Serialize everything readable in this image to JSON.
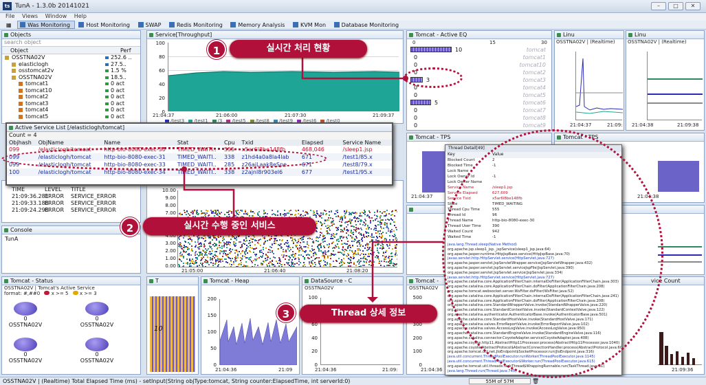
{
  "app": {
    "title": "TunA - 1.3.0b 20141021",
    "menu": [
      "File",
      "Views",
      "Window",
      "Help"
    ]
  },
  "toolbar": [
    "Was Monitoring",
    "Host Monitoring",
    "SWAP",
    "Redis Monitoring",
    "Memory Analysis",
    "KVM Mon",
    "Database Monitoring"
  ],
  "objects": {
    "title": "Objects",
    "search": "search object",
    "col_object": "Object",
    "col_perf": "Perf",
    "rows": [
      {
        "name": "OSSTNA02V",
        "perf": "252.6 .."
      },
      {
        "name": "elasticlogh",
        "perf": "27.5.."
      },
      {
        "name": "osstomcat2v",
        "perf": "1.5 %"
      },
      {
        "name": "OSSTNA02V",
        "perf": "18.5.."
      },
      {
        "name": "tomcat1",
        "perf": "0 act"
      },
      {
        "name": "tomcat10",
        "perf": "0 act"
      },
      {
        "name": "tomcat2",
        "perf": "0 act"
      },
      {
        "name": "tomcat3",
        "perf": "0 act"
      },
      {
        "name": "tomcat4",
        "perf": "0 act"
      },
      {
        "name": "tomcat5",
        "perf": "0 act"
      }
    ]
  },
  "throughput": {
    "title": "Service[Throughput]",
    "yticks": [
      "100",
      "80",
      "60",
      "40",
      "20",
      "0"
    ],
    "xticks": [
      "21:04:37",
      "21:06:00",
      "21:07:30",
      "21:09:37"
    ],
    "legend": [
      "/test3",
      "/test1",
      "/3",
      "/test5",
      "/test8",
      "/test9",
      "/test6",
      "/test0"
    ]
  },
  "active_eq": {
    "title": "Tomcat - Active EQ",
    "scale": [
      "0",
      "15",
      "30"
    ],
    "rows": [
      {
        "label": "tomcat",
        "count": "10"
      },
      {
        "label": "tomcat1",
        "count": "0"
      },
      {
        "label": "tomcat10",
        "count": "0"
      },
      {
        "label": "tomcat2",
        "count": "0"
      },
      {
        "label": "tomcat3",
        "count": "3"
      },
      {
        "label": "tomcat4",
        "count": "0"
      },
      {
        "label": "tomcat5",
        "count": "0"
      },
      {
        "label": "tomcat6",
        "count": "5"
      },
      {
        "label": "tomcat7",
        "count": "0"
      },
      {
        "label": "tomcat8",
        "count": "0"
      },
      {
        "label": "tomcat9",
        "count": "0"
      }
    ]
  },
  "linux1": {
    "title": "Linu",
    "subtitle": "OSSTNA02V | (Realtime)",
    "yticks": [
      "100",
      "80",
      "60",
      "40",
      "20",
      "0"
    ],
    "xticks": [
      "21:04:37",
      "21:09:"
    ]
  },
  "linux2": {
    "title": "Linu",
    "subtitle": "OSSTNA02V | (Realtime)",
    "yticks": [
      "100",
      "80",
      "60",
      "40",
      "20",
      "0"
    ],
    "xticks": [
      "21:04:38",
      "21:09:38"
    ]
  },
  "active_service": {
    "title": "Active Service List [/elasticlogh/tomcat]",
    "count": "Count = 4",
    "headers": [
      "Objhash",
      "ObjName",
      "Name",
      "Stat",
      "Cpu",
      "Txid",
      "Elapsed",
      "Service Name"
    ],
    "rows": [
      {
        "hash": "099",
        "obj": "/elasticlogh/tomcat",
        "name": "http-bio-8080-exec-30",
        "stat": "TIMED_WAITI..",
        "cpu": "555",
        "txid": "x5ar6l8be148fb",
        "elapsed": "468,046",
        "svc": "/sleep1.jsp"
      },
      {
        "hash": "099",
        "obj": "/elasticlogh/tomcat",
        "name": "http-bio-8080-exec-31",
        "stat": "TIMED_WAITI..",
        "cpu": "338",
        "txid": "z1hd4a0a8la4lab",
        "elapsed": "671",
        "svc": "/test1/85.x"
      },
      {
        "hash": "099",
        "obj": "/elasticlogh/tomcat",
        "name": "http-bio-8080-exec-33",
        "stat": "TIMED_WAITI..",
        "cpu": "285",
        "txid": "z26ajLaak8eSpe",
        "elapsed": "671",
        "svc": "/test8/79.x"
      },
      {
        "hash": "100",
        "obj": "/elasticlogh/tomcat",
        "name": "http-bio-8080-exec-34",
        "stat": "TIMED_WAITI..",
        "cpu": "338",
        "txid": "z2ajnl8r903el6",
        "elapsed": "677",
        "svc": "/test1/95.x"
      }
    ]
  },
  "alerts": {
    "headers": [
      "TIME",
      "LEVEL",
      "TITLE"
    ],
    "rows": [
      {
        "time": "21:09:36.281",
        "level": "ERROR",
        "title": "SERVICE_ERROR"
      },
      {
        "time": "21:09:33.188",
        "level": "ERROR",
        "title": "SERVICE_ERROR"
      },
      {
        "time": "21:09:24.298",
        "level": "ERROR",
        "title": "SERVICE_ERROR"
      }
    ]
  },
  "console": {
    "title": "Console",
    "text": "TunA"
  },
  "scatter": {
    "yticks": [
      "10.00",
      "9.00",
      "8.00",
      "7.00",
      "6.00",
      "5.00",
      "4.00",
      "3.00",
      "2.00",
      "1.00",
      "0.00"
    ],
    "xticks": [
      "21:05:00",
      "21:06:40",
      "21:08:20"
    ]
  },
  "status_panel": {
    "title": "Tomcat - Status",
    "subtitle": "OSSTNA02V | Tomcat's Active Service",
    "format": "format: #,##0",
    "legend1": "x >= 5",
    "legend2": "x >= 3",
    "items": [
      {
        "count": "0",
        "label": "OSSTNA02V"
      },
      {
        "count": "0",
        "label": "OSSTNA02V"
      },
      {
        "count": "0",
        "label": "OSSTNA02V"
      },
      {
        "count": "0",
        "label": "OSSTNA02V"
      }
    ]
  },
  "tps1": {
    "title": "Tomcat - TPS",
    "xtick": "21:04:37"
  },
  "tps2": {
    "title": "Tomcat - TPS",
    "xtick": "21:04:38"
  },
  "thread_detail": {
    "title": "Thread Detail[49]",
    "key": "Key",
    "value": "Value",
    "rows": [
      [
        "Blocked Count",
        "2"
      ],
      [
        "Blocked Time",
        "-1"
      ],
      [
        "Lock Name",
        ""
      ],
      [
        "Lock Owner Id",
        "-1"
      ],
      [
        "Lock Owner Name",
        ""
      ],
      [
        "Service Name",
        "/sleep1.jsp"
      ],
      [
        "Service Elapsed",
        "627,609"
      ],
      [
        "Service Txid",
        "x5ar6l8be148fb"
      ],
      [
        "State",
        "TIMED_WAITING"
      ],
      [
        "Thread Cpu Time",
        "555"
      ],
      [
        "Thread Id",
        "96"
      ],
      [
        "Thread Name",
        "http-bio-8080-exec-30"
      ],
      [
        "Thread User Time",
        "390"
      ],
      [
        "Waited Count",
        "942"
      ],
      [
        "Waited Time",
        "-1"
      ]
    ],
    "stack": [
      "java.lang.Thread.sleep(Native Method)",
      "org.apache.jsp.sleep1_jsp._jspService(sleep1_jsp.java:64)",
      "org.apache.jasper.runtime.HttpJspBase.service(HttpJspBase.java:70)",
      "javax.servlet.http.HttpServlet.service(HttpServlet.java:727)",
      "org.apache.jasper.servlet.JspServletWrapper.service(JspServletWrapper.java:432)",
      "org.apache.jasper.servlet.JspServlet.serviceJspFile(JspServlet.java:390)",
      "org.apache.jasper.servlet.JspServlet.service(JspServlet.java:334)",
      "javax.servlet.http.HttpServlet.service(HttpServlet.java:727)",
      "org.apache.catalina.core.ApplicationFilterChain.internalDoFilter(ApplicationFilterChain.java:303)",
      "org.apache.catalina.core.ApplicationFilterChain.doFilter(ApplicationFilterChain.java:208)",
      "org.apache.tomcat.websocket.server.WsFilter.doFilter(WsFilter.java:52)",
      "org.apache.catalina.core.ApplicationFilterChain.internalDoFilter(ApplicationFilterChain.java:241)",
      "org.apache.catalina.core.ApplicationFilterChain.doFilter(ApplicationFilterChain.java:208)",
      "org.apache.catalina.core.StandardWrapperValve.invoke(StandardWrapperValve.java:220)",
      "org.apache.catalina.core.StandardContextValve.invoke(StandardContextValve.java:122)",
      "org.apache.catalina.authenticator.AuthenticatorBase.invoke(AuthenticatorBase.java:501)",
      "org.apache.catalina.core.StandardHostValve.invoke(StandardHostValve.java:171)",
      "org.apache.catalina.valves.ErrorReportValve.invoke(ErrorReportValve.java:102)",
      "org.apache.catalina.valves.AccessLogValve.invoke(AccessLogValve.java:950)",
      "org.apache.catalina.core.StandardEngineValve.invoke(StandardEngineValve.java:116)",
      "org.apache.catalina.connector.CoyoteAdapter.service(CoyoteAdapter.java:408)",
      "org.apache.coyote.http11.AbstractHttp11Processor.process(AbstractHttp11Processor.java:1040)",
      "org.apache.coyote.AbstractProtocol$AbstractConnectionHandler.process(AbstractProtocol.java:607)",
      "org.apache.tomcat.util.net.JIoEndpoint$SocketProcessor.run(JIoEndpoint.java:316)",
      "java.util.concurrent.ThreadPoolExecutor.runWorker(ThreadPoolExecutor.java:1145)",
      "java.util.concurrent.ThreadPoolExecutor$Worker.run(ThreadPoolExecutor.java:615)",
      "org.apache.tomcat.util.threads.TaskThread$WrappingRunnable.run(TaskThread.java:61)",
      "java.lang.Thread.run(Thread.java:745)"
    ]
  },
  "heap": {
    "title": "Tomcat - Heap",
    "yticks": [
      "200",
      "150",
      "100",
      "50",
      "0"
    ],
    "xticks": [
      "21:04:36",
      "21:09"
    ]
  },
  "t_panel": {
    "title": "T",
    "label": "10"
  },
  "datasource": {
    "title": "DataSource - C",
    "subtitle": "OSSTNA02V",
    "yticks": [
      "100",
      "80",
      "60",
      "40",
      "20",
      "0"
    ],
    "xticks": [
      "21:04:36",
      "21:09:"
    ]
  },
  "tomcat_last": {
    "title": "Tomcat -",
    "subtitle": "OSSTNA02V",
    "yticks": [
      "500",
      "400",
      "300",
      "200",
      "100",
      "0"
    ],
    "xticks": [
      "21:04:36"
    ]
  },
  "service_count": {
    "title": "vice Count",
    "xtick": "21:09:36"
  },
  "statusbar": {
    "text": "OSSTNA02V | (Realtime) Total Elapsed Time (ms) - setInput(String objType:tomcat, String counter:ElapsedTime, int serverId:0)",
    "memory": "55M of 57M"
  },
  "callouts": [
    {
      "num": "1",
      "text": "실시간 처리 현황"
    },
    {
      "num": "2",
      "text": "실시간 수행 중인 서비스"
    },
    {
      "num": "3",
      "text": "Thread 상세 정보"
    }
  ],
  "colors": {
    "accent": "#b0103a",
    "throughput": "#1fa596"
  }
}
